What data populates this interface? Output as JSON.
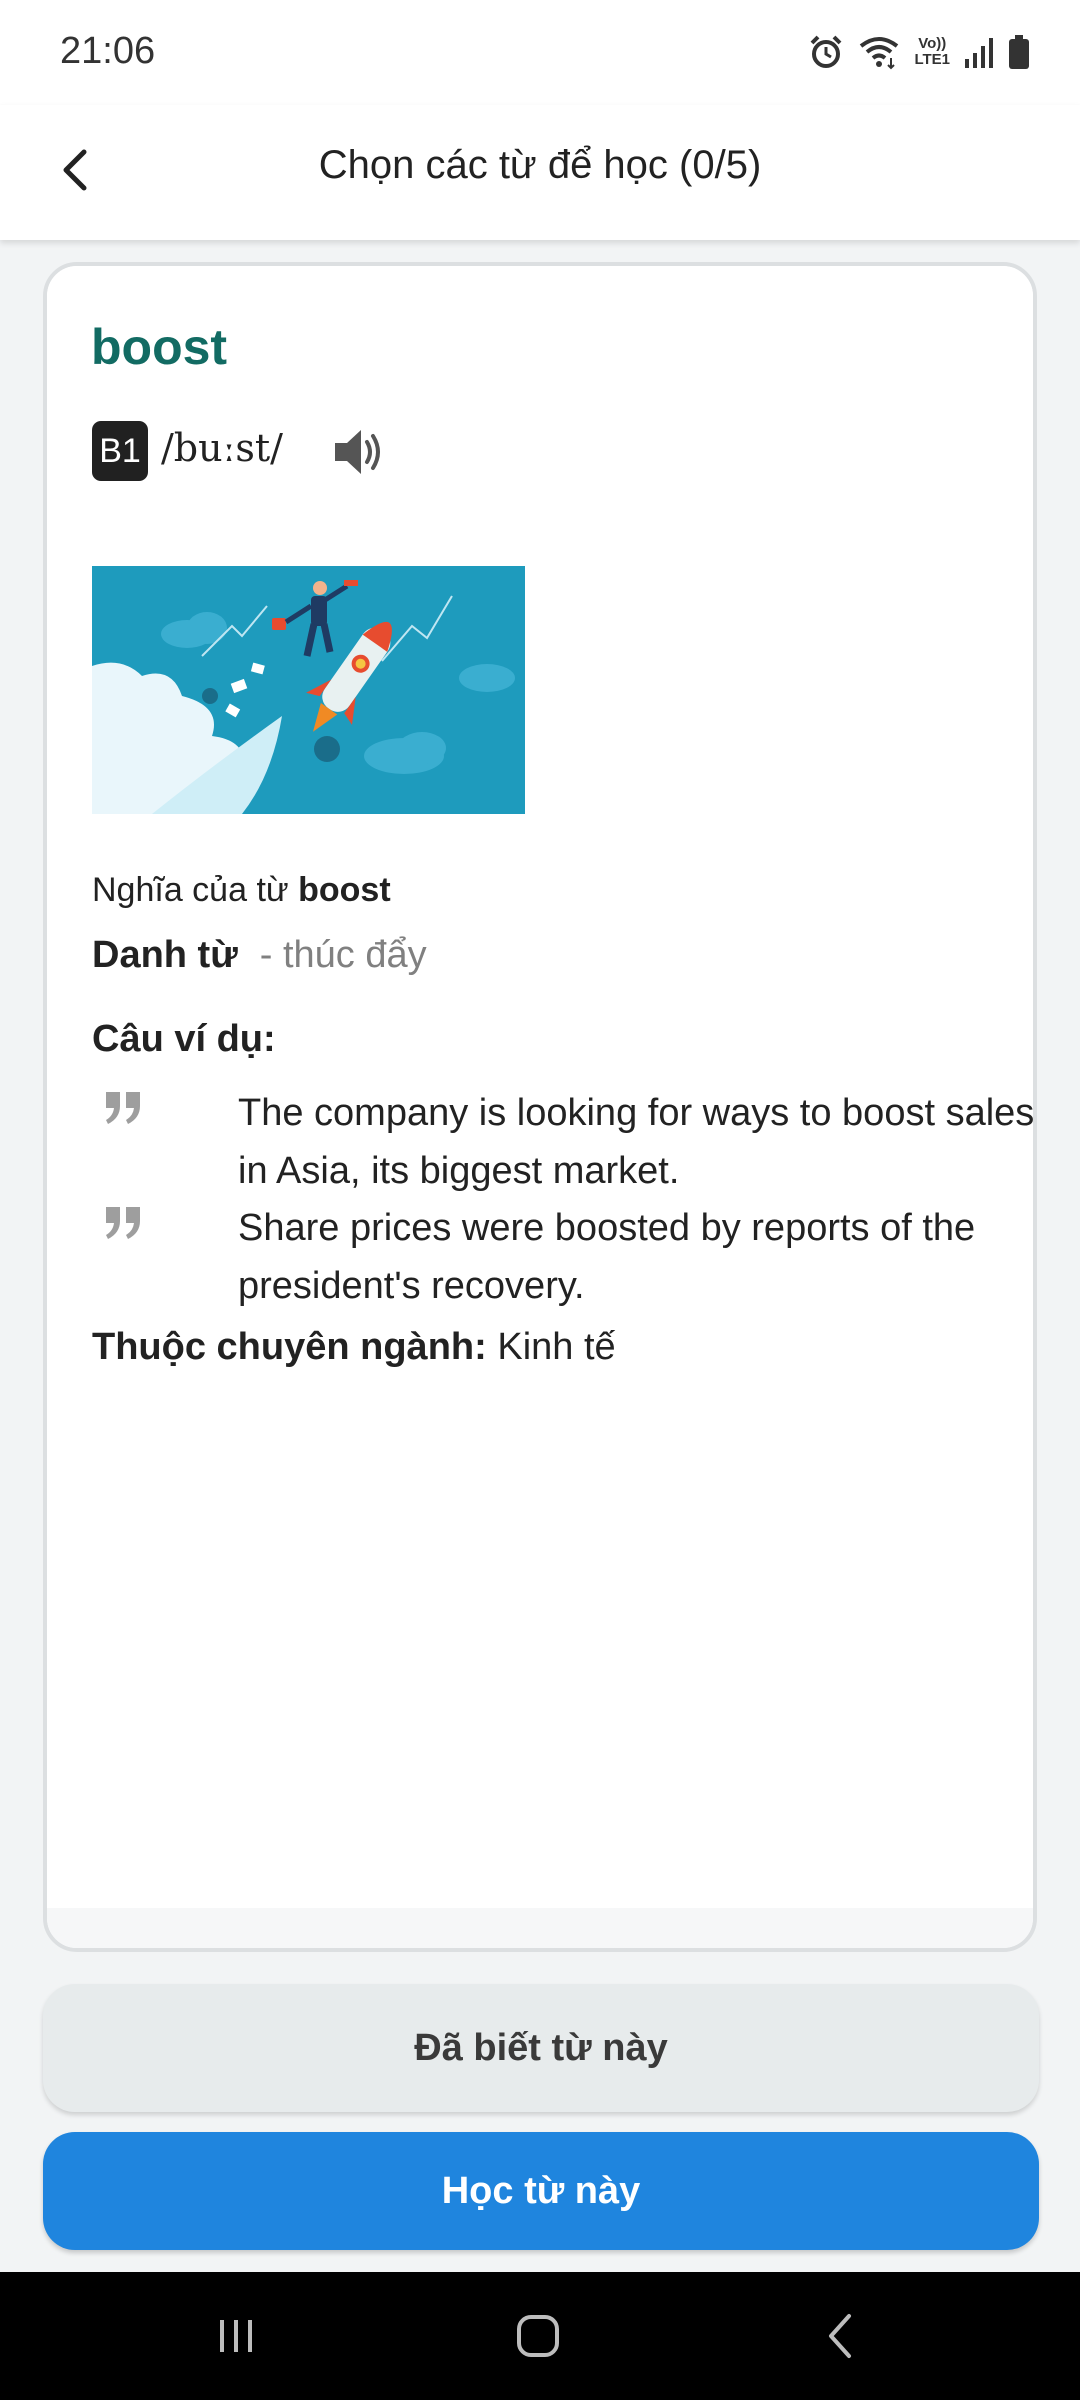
{
  "status_bar": {
    "time": "21:06",
    "icons": [
      "alarm-icon",
      "wifi-icon",
      "volte-lte-icon",
      "signal-icon",
      "battery-icon"
    ],
    "volte_label_top": "Vo))",
    "volte_label_bottom": "LTE1"
  },
  "app_bar": {
    "back_icon": "back-arrow-icon",
    "title": "Chọn các từ để học (0/5)"
  },
  "card": {
    "word": "boost",
    "level": "B1",
    "ipa": "/buːst/",
    "speaker_icon": "speaker-icon",
    "image_alt": "businessman riding a rocket",
    "meaning_prefix": "Nghĩa của từ",
    "meaning_word": "boost",
    "part_of_speech": "Danh từ",
    "meaning": "- thúc đẩy",
    "examples_title": "Câu ví dụ:",
    "examples": [
      {
        "icon": "quote-icon",
        "text": "The company is looking for ways to boost sales in Asia, its biggest market."
      },
      {
        "icon": "quote-icon",
        "text": "Share prices were boosted by reports of the president's recovery."
      }
    ],
    "field_label": "Thuộc chuyên ngành:",
    "field_value": "Kinh tế"
  },
  "buttons": {
    "known_label": "Đã biết từ này",
    "learn_label": "Học từ này"
  },
  "nav_bar": {
    "icons": [
      "recent-apps-icon",
      "home-icon",
      "nav-back-icon"
    ]
  },
  "colors": {
    "accent": "#1f85de",
    "word": "#126b63",
    "secondary_button": "#e7ebec"
  }
}
